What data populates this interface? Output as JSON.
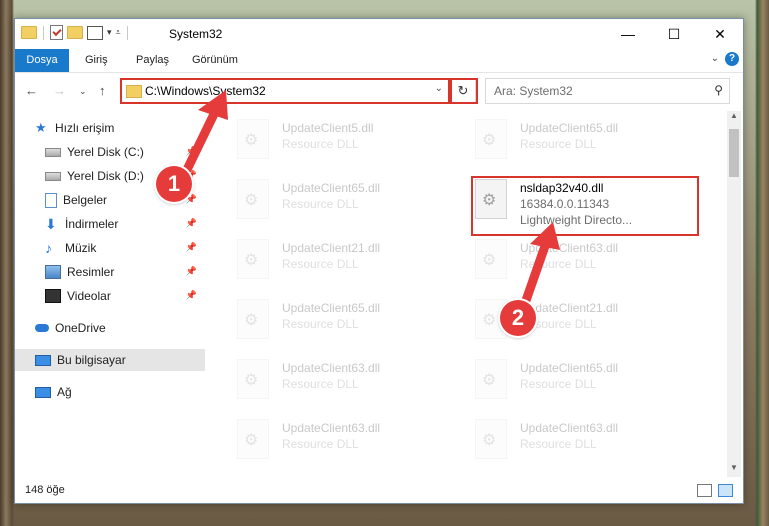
{
  "window": {
    "title": "System32"
  },
  "ribbon": {
    "tabs": [
      "Dosya",
      "Giriş",
      "Paylaş",
      "Görünüm"
    ]
  },
  "address": {
    "path": "C:\\Windows\\System32"
  },
  "search": {
    "placeholder": "Ara: System32"
  },
  "sidebar": {
    "items": [
      {
        "label": "Hızlı erişim",
        "icon": "star-icon"
      },
      {
        "label": "Yerel Disk (C:)",
        "icon": "drive-icon",
        "pinned": true
      },
      {
        "label": "Yerel Disk (D:)",
        "icon": "drive-icon",
        "pinned": true
      },
      {
        "label": "Belgeler",
        "icon": "document-icon",
        "pinned": true
      },
      {
        "label": "İndirmeler",
        "icon": "download-icon",
        "pinned": true
      },
      {
        "label": "Müzik",
        "icon": "music-icon",
        "pinned": true
      },
      {
        "label": "Resimler",
        "icon": "pictures-icon",
        "pinned": true
      },
      {
        "label": "Videolar",
        "icon": "videos-icon",
        "pinned": true
      },
      {
        "label": "OneDrive",
        "icon": "cloud-icon"
      },
      {
        "label": "Bu bilgisayar",
        "icon": "computer-icon",
        "selected": true
      },
      {
        "label": "Ağ",
        "icon": "network-icon"
      }
    ]
  },
  "files": {
    "left": [
      {
        "name": "UpdateClient5.dll",
        "desc": "Resource DLL"
      },
      {
        "name": "UpdateClient65.dll",
        "desc": "Resource DLL"
      },
      {
        "name": "UpdateClient21.dll",
        "desc": "Resource DLL"
      },
      {
        "name": "UpdateClient65.dll",
        "desc": "Resource DLL"
      },
      {
        "name": "UpdateClient63.dll",
        "desc": "Resource DLL"
      },
      {
        "name": "UpdateClient63.dll",
        "desc": "Resource DLL"
      }
    ],
    "right": [
      {
        "name": "UpdateClient65.dll",
        "desc": "Resource DLL"
      },
      {
        "name": "nsldap32v40.dll",
        "desc": "16384.0.0.11343",
        "desc2": "Lightweight Directo...",
        "highlight": true
      },
      {
        "name": "UpdateClient63.dll",
        "desc": "Resource DLL"
      },
      {
        "name": "UpdateClient21.dll",
        "desc": "Resource DLL"
      },
      {
        "name": "UpdateClient65.dll",
        "desc": "Resource DLL"
      },
      {
        "name": "UpdateClient63.dll",
        "desc": "Resource DLL"
      }
    ]
  },
  "status": {
    "count": "148 öğe"
  },
  "annotations": {
    "step1": "1",
    "step2": "2",
    "color": "#e53b3b"
  }
}
